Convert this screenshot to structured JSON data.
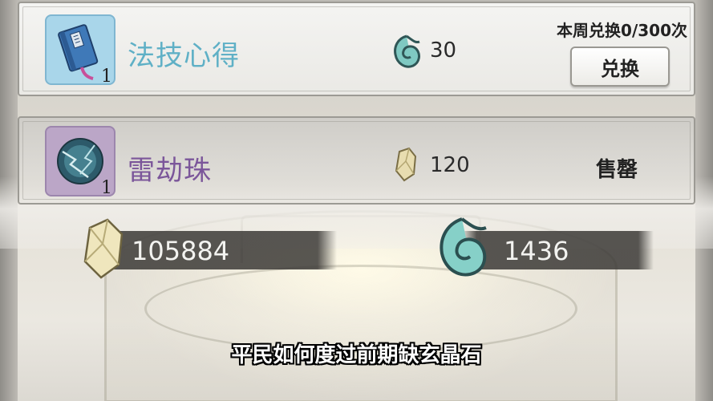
{
  "items": [
    {
      "name": "法技心得",
      "count": "1",
      "icon": "blue-book-icon",
      "cost_icon": "xuan-spiral-currency-icon",
      "cost": "30",
      "limit_text": "本周兑换0/300次",
      "action_label": "兑换"
    },
    {
      "name": "雷劫珠",
      "count": "1",
      "icon": "thunder-orb-icon",
      "cost_icon": "crystal-stone-icon",
      "cost": "120",
      "status_label": "售罄"
    }
  ],
  "currencies": [
    {
      "icon": "crystal-stone-icon",
      "value": "105884"
    },
    {
      "icon": "xuan-spiral-currency-icon",
      "value": "1436"
    }
  ],
  "subtitle": "平民如何度过前期缺玄晶石",
  "colors": {
    "name_blue": "#5fb0c6",
    "name_purple": "#7b569a",
    "frame_blue": "#a9d6ea",
    "frame_purple": "#bba6c7",
    "spiral_teal": "#5fb8b0",
    "crystal_gold": "#e6dcae"
  }
}
